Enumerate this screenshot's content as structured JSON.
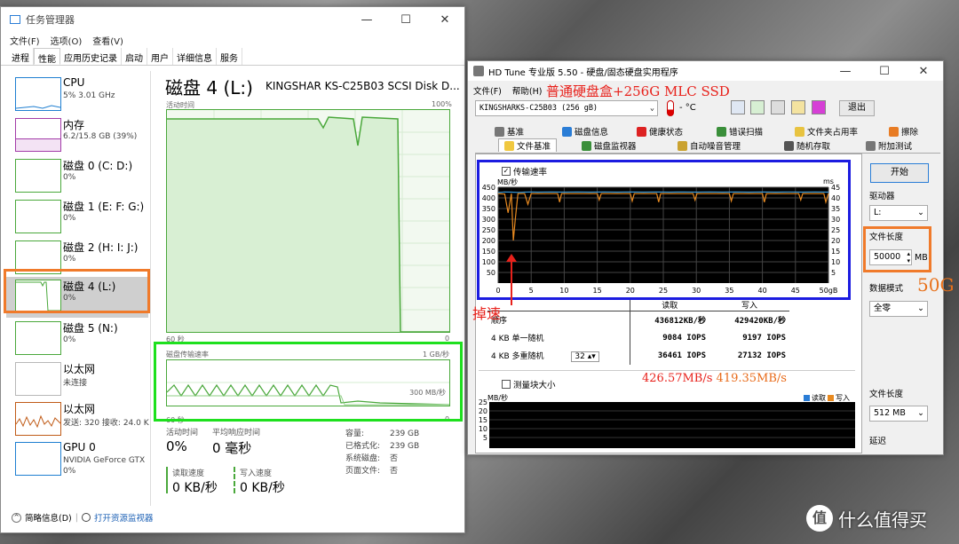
{
  "task_manager": {
    "title": "任务管理器",
    "menu": [
      "文件(F)",
      "选项(O)",
      "查看(V)"
    ],
    "tabs": [
      "进程",
      "性能",
      "应用历史记录",
      "启动",
      "用户",
      "详细信息",
      "服务"
    ],
    "devices": [
      {
        "name": "CPU",
        "sub": "5% 3.01 GHz",
        "sub2": ""
      },
      {
        "name": "内存",
        "sub": "6.2/15.8 GB (39%)",
        "sub2": ""
      },
      {
        "name": "磁盘 0 (C: D:)",
        "sub": "0%",
        "sub2": ""
      },
      {
        "name": "磁盘 1 (E: F: G:)",
        "sub": "0%",
        "sub2": ""
      },
      {
        "name": "磁盘 2 (H: I: J:)",
        "sub": "0%",
        "sub2": ""
      },
      {
        "name": "磁盘 4 (L:)",
        "sub": "0%",
        "sub2": ""
      },
      {
        "name": "磁盘 5 (N:)",
        "sub": "0%",
        "sub2": ""
      },
      {
        "name": "以太网",
        "sub": "未连接",
        "sub2": ""
      },
      {
        "name": "以太网",
        "sub": "发送: 320 接收: 24.0 K",
        "sub2": ""
      },
      {
        "name": "GPU 0",
        "sub": "NVIDIA GeForce GTX",
        "sub2": "0%"
      }
    ],
    "disk_title": "磁盘 4 (L:)",
    "disk_model": "KINGSHAR KS-C25B03 SCSI Disk D...",
    "graph1": {
      "top_left": "活动时间",
      "top_right": "100%",
      "bottom_left": "60 秒",
      "bottom_right": "0"
    },
    "graph2": {
      "top_left": "磁盘传输速率",
      "top_right": "1 GB/秒",
      "mid_right": "300 MB/秒",
      "bottom_left": "60 秒",
      "bottom_right": "0"
    },
    "stats": {
      "active_label": "活动时间",
      "active_value": "0%",
      "resp_label": "平均响应时间",
      "resp_value": "0 毫秒",
      "read_label": "读取速度",
      "read_value": "0 KB/秒",
      "write_label": "写入速度",
      "write_value": "0 KB/秒"
    },
    "props": [
      {
        "k": "容量:",
        "v": "239 GB"
      },
      {
        "k": "已格式化:",
        "v": "239 GB"
      },
      {
        "k": "系统磁盘:",
        "v": "否"
      },
      {
        "k": "页面文件:",
        "v": "否"
      }
    ],
    "footer_brief": "简略信息(D)",
    "footer_link": "打开资源监视器"
  },
  "hdtune": {
    "title": "HD Tune 专业版 5.50 - 硬盘/固态硬盘实用程序",
    "menu": [
      "文件(F)",
      "帮助(H)"
    ],
    "annotation_title": "普通硬盘盒+256G MLC SSD",
    "drive": "KINGSHARKS-C25B03 (256 gB)",
    "temp": "- °C",
    "exit": "退出",
    "tabs_row1": [
      "基准",
      "磁盘信息",
      "健康状态",
      "错误扫描",
      "文件夹占用率",
      "擦除"
    ],
    "tabs_row2": [
      "文件基准",
      "磁盘监视器",
      "自动噪音管理",
      "随机存取",
      "附加测试"
    ],
    "checkbox_transfer": "传输速率",
    "chart_unit_left": "MB/秒",
    "chart_unit_right": "ms",
    "start": "开始",
    "drive_label": "驱动器",
    "drive_value": "L:",
    "file_len_label": "文件长度",
    "file_len_value": "50000",
    "file_len_unit": "MB",
    "annot_50g": "50G",
    "data_mode_label": "数据模式",
    "data_mode_value": "全零",
    "annot_drop": "掉速",
    "results": {
      "col_read": "读取",
      "col_write": "写入",
      "rows": [
        {
          "label": "顺序",
          "read": "436812KB/秒",
          "write": "429420KB/秒"
        },
        {
          "label": "4 KB 单一随机",
          "read": "9084 IOPS",
          "write": "9197 IOPS"
        },
        {
          "label": "4 KB 多重随机",
          "read": "36461 IOPS",
          "write": "27132 IOPS"
        }
      ],
      "queue": "32"
    },
    "annot_speed_read": "426.57MB/s",
    "annot_speed_write": "419.35MB/s",
    "block_size_label": "测量块大小",
    "bottom_unit": "MB/秒",
    "legend_read": "读取",
    "legend_write": "写入",
    "file_len2_label": "文件长度",
    "file_len2_value": "512 MB",
    "delay_label": "延迟",
    "bottom_yticks": [
      "25",
      "20",
      "15",
      "10",
      "5"
    ]
  },
  "watermark": "什么值得买",
  "chart_data": {
    "type": "line",
    "title": "",
    "xlabel": "gB",
    "ylabel": "MB/秒",
    "y2label": "ms",
    "x_ticks": [
      "0",
      "5",
      "10",
      "15",
      "20",
      "25",
      "30",
      "35",
      "40",
      "45",
      "50gB"
    ],
    "y_ticks": [
      "450",
      "400",
      "350",
      "300",
      "250",
      "200",
      "150",
      "100",
      "50"
    ],
    "y2_ticks": [
      "45",
      "40",
      "35",
      "30",
      "25",
      "20",
      "15",
      "10",
      "5"
    ],
    "xlim": [
      0,
      50
    ],
    "ylim": [
      0,
      450
    ],
    "y2lim": [
      0,
      45
    ],
    "series": [
      {
        "name": "传输速率",
        "color": "#3a9ad9",
        "x": [
          0,
          1,
          2,
          3,
          4,
          5,
          6,
          8,
          10,
          12,
          14,
          16,
          18,
          20,
          22,
          24,
          26,
          28,
          30,
          32,
          34,
          36,
          38,
          40,
          42,
          44,
          46,
          48,
          50
        ],
        "values": [
          425,
          428,
          427,
          426,
          427,
          428,
          427,
          428,
          427,
          428,
          427,
          428,
          427,
          428,
          427,
          428,
          427,
          428,
          427,
          428,
          427,
          428,
          427,
          428,
          427,
          428,
          427,
          428,
          427
        ]
      },
      {
        "name": "",
        "color": "#e88a20",
        "x": [
          0,
          1,
          1.5,
          2,
          2.3,
          2.6,
          3,
          4,
          4.5,
          5,
          9,
          9.3,
          9.6,
          15,
          15.3,
          15.6,
          20,
          20.3,
          20.6,
          24,
          24.3,
          24.6,
          29.5,
          29.8,
          30.1,
          35,
          35.3,
          35.6,
          40,
          40.3,
          40.6,
          45.5,
          45.8,
          46.1,
          49.3,
          49.6,
          50
        ],
        "values": [
          420,
          418,
          330,
          420,
          200,
          300,
          420,
          420,
          370,
          420,
          420,
          380,
          420,
          420,
          390,
          420,
          420,
          385,
          420,
          420,
          380,
          420,
          420,
          390,
          420,
          420,
          385,
          420,
          420,
          380,
          420,
          420,
          390,
          420,
          420,
          380,
          420
        ]
      }
    ]
  }
}
